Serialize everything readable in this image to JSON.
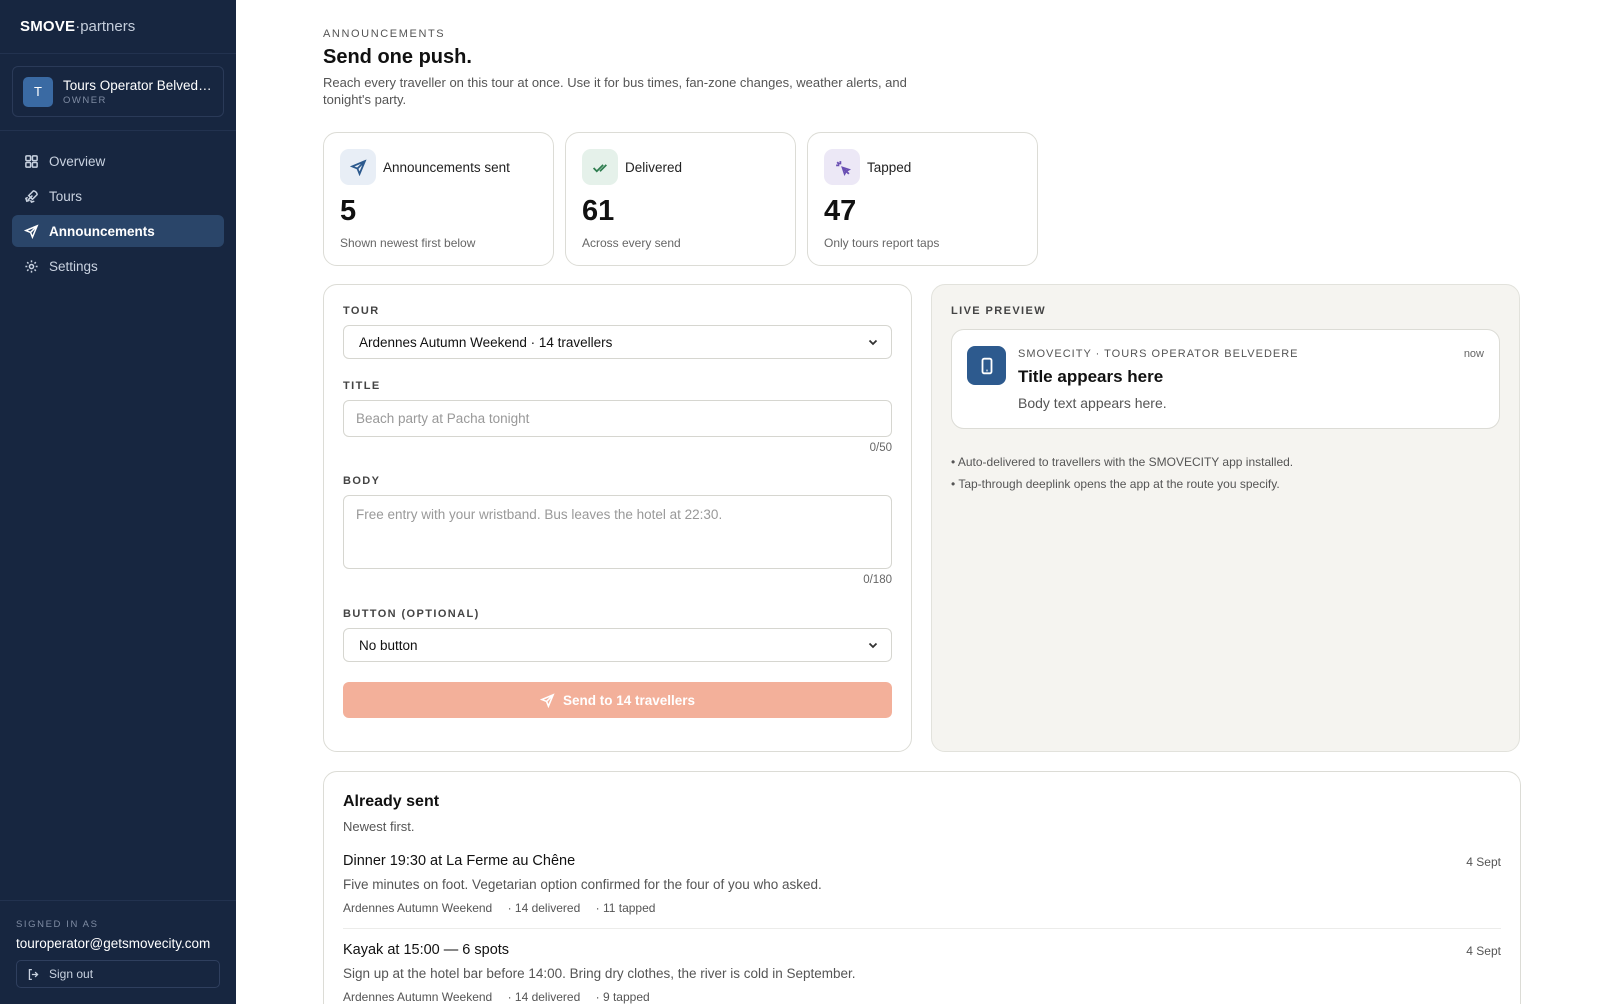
{
  "brand": {
    "name": "SMOVE",
    "separator": "·",
    "suffix": "partners"
  },
  "org": {
    "initial": "T",
    "name": "Tours Operator Belvedere",
    "role": "OWNER"
  },
  "nav": [
    {
      "label": "Overview",
      "icon": "grid-icon"
    },
    {
      "label": "Tours",
      "icon": "rocket-icon"
    },
    {
      "label": "Announcements",
      "icon": "send-icon",
      "active": true
    },
    {
      "label": "Settings",
      "icon": "gear-icon"
    }
  ],
  "account": {
    "label": "SIGNED IN AS",
    "email": "touroperator@getsmovecity.com",
    "signout": "Sign out"
  },
  "header": {
    "eyebrow": "ANNOUNCEMENTS",
    "title": "Send one push.",
    "description": "Reach every traveller on this tour at once. Use it for bus times, fan-zone changes, weather alerts, and tonight's party."
  },
  "stats": [
    {
      "label": "Announcements sent",
      "value": "5",
      "sub": "Shown newest first below",
      "icon": "send-icon",
      "color": "#2d5a8e",
      "bg": "#e8eef6"
    },
    {
      "label": "Delivered",
      "value": "61",
      "sub": "Across every send",
      "icon": "double-check-icon",
      "color": "#2e7d4f",
      "bg": "#e5f1ea"
    },
    {
      "label": "Tapped",
      "value": "47",
      "sub": "Only tours report taps",
      "icon": "sparkle-icon",
      "color": "#6a4fb3",
      "bg": "#ece8f6"
    }
  ],
  "form": {
    "tour_label": "TOUR",
    "tour_value": "Ardennes Autumn Weekend · 14 travellers",
    "title_label": "TITLE",
    "title_placeholder": "Beach party at Pacha tonight",
    "title_counter": "0/50",
    "body_label": "BODY",
    "body_placeholder": "Free entry with your wristband. Bus leaves the hotel at 22:30.",
    "body_counter": "0/180",
    "button_label": "BUTTON (OPTIONAL)",
    "button_value": "No button",
    "send_label": "Send to 14 travellers"
  },
  "preview": {
    "label": "LIVE PREVIEW",
    "app": "SMOVECITY · TOURS OPERATOR BELVEDERE",
    "time": "now",
    "title": "Title appears here",
    "body": "Body text appears here.",
    "notes": [
      "Auto-delivered to travellers with the SMOVECITY app installed.",
      "Tap-through deeplink opens the app at the route you specify."
    ]
  },
  "sent": {
    "title": "Already sent",
    "subtitle": "Newest first.",
    "items": [
      {
        "title": "Dinner 19:30 at La Ferme au Chêne",
        "body": "Five minutes on foot. Vegetarian option confirmed for the four of you who asked.",
        "tour": "Ardennes Autumn Weekend",
        "delivered": "· 14 delivered",
        "tapped": "· 11 tapped",
        "date": "4 Sept"
      },
      {
        "title": "Kayak at 15:00 — 6 spots",
        "body": "Sign up at the hotel bar before 14:00. Bring dry clothes, the river is cold in September.",
        "tour": "Ardennes Autumn Weekend",
        "delivered": "· 14 delivered",
        "tapped": "· 9 tapped",
        "date": "4 Sept"
      }
    ]
  }
}
